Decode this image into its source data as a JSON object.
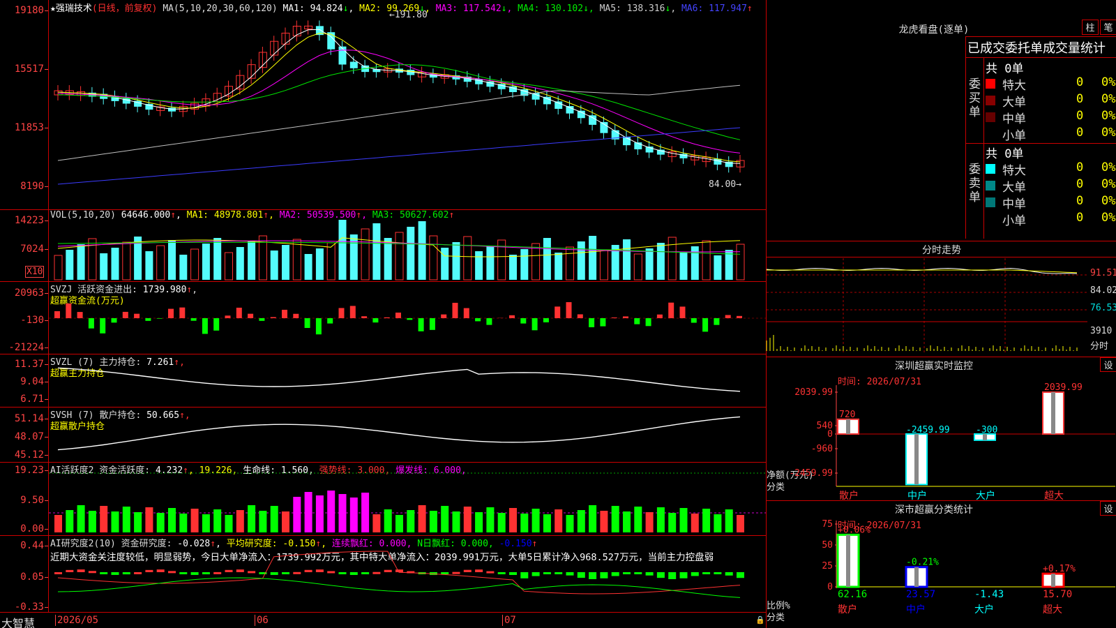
{
  "app": {
    "brand": "大智慧",
    "star": "★",
    "stock_name": "强瑞技术",
    "mode": "(日线，前复权)"
  },
  "colors": {
    "up": "#ff3232",
    "down": "#54fcfc",
    "ma1": "#ffffff",
    "ma2": "#ffff00",
    "ma3": "#ff00ff",
    "ma4": "#00e600",
    "ma5": "#c0c0c0",
    "ma6": "#3c3cff",
    "axis": "#ff4040",
    "grid": "#c00000",
    "green": "#00ff00",
    "magenta": "#ff00ff"
  },
  "kline": {
    "ma_prefix": "MA(5,10,20,30,60,120)",
    "ma": [
      {
        "label": "MA1:",
        "value": "94.824",
        "arrow": "↓"
      },
      {
        "label": "MA2:",
        "value": "99.269",
        "arrow": "↓"
      },
      {
        "label": "MA3:",
        "value": "117.542",
        "arrow": "↓"
      },
      {
        "label": "MA4:",
        "value": "130.102",
        "arrow": "↓"
      },
      {
        "label": "MA5:",
        "value": "138.316",
        "arrow": "↓"
      },
      {
        "label": "MA6:",
        "value": "117.947",
        "arrow": "↑"
      }
    ],
    "ticks": [
      "19180",
      "15517",
      "11853",
      "8190"
    ],
    "high_label": "191.80",
    "low_label": "84.00"
  },
  "vol": {
    "prefix": "VOL(5,10,20)",
    "value": "64646.000",
    "arrow": "↑",
    "ma": [
      {
        "label": "MA1:",
        "value": "48978.801",
        "arrow": "↑"
      },
      {
        "label": "MA2:",
        "value": "50539.500",
        "arrow": "↑"
      },
      {
        "label": "MA3:",
        "value": "50627.602",
        "arrow": "↑"
      }
    ],
    "ticks": [
      "14223",
      "7024"
    ],
    "unit": "X10"
  },
  "svzj": {
    "title": "SVZJ  活跃资金进出:",
    "value": "1739.980",
    "arrow": "↑",
    "subtitle": "超赢资金流(万元)",
    "ticks": [
      "20963",
      "-130",
      "-21224"
    ]
  },
  "svzl": {
    "title": "SVZL (7) 主力持仓:",
    "value": "7.261",
    "arrow": "↑,",
    "subtitle": "超赢主力持仓",
    "ticks": [
      "11.37",
      "9.04",
      "6.71"
    ]
  },
  "svsh": {
    "title": "SVSH (7) 散户持仓:",
    "value": "50.665",
    "arrow": "↑,",
    "subtitle": "超赢散户持仓",
    "ticks": [
      "51.14",
      "48.07",
      "45.12"
    ]
  },
  "ai1": {
    "title": "AI活跃度2 资金活跃度:",
    "value": "4.232",
    "v2": "19.226,",
    "v3": "生命线: 1.560,",
    "v4": "强势线: 3.000,",
    "v5": "爆发线: 6.000,",
    "ticks": [
      "19.23",
      "9.50",
      "0.00"
    ]
  },
  "ai2": {
    "title": "AI研究度2(10) 资金研究度:",
    "value": "-0.028",
    "v2": "平均研究度: -0.150",
    "v3": "连续飘红: 0.000,",
    "v4": "N日飘红: 0.000,",
    "v5": "-0.150",
    "ticks": [
      "0.44",
      "0.05",
      "-0.33"
    ],
    "comment": "近期大资金关注度较低，明显弱势，今日大单净流入：1739.992万元，其中特大单净流入：2039.991万元，大单5日累计净入968.527万元，当前主力控盘弱"
  },
  "dates": [
    "2026/05",
    "06",
    "07"
  ],
  "dragon": {
    "title": "龙虎看盘(逐单)",
    "tab1": "柱",
    "tab2": "笔",
    "header": "已成交委托单成交量统计",
    "buy": {
      "side": "委买单",
      "total": "共 0单",
      "rows": [
        {
          "name": "特大",
          "v": "0",
          "p": "0%"
        },
        {
          "name": "大单",
          "v": "0",
          "p": "0%"
        },
        {
          "name": "中单",
          "v": "0",
          "p": "0%"
        },
        {
          "name": "小单",
          "v": "0",
          "p": "0%"
        }
      ]
    },
    "sell": {
      "side": "委卖单",
      "total": "共 0单",
      "rows": [
        {
          "name": "特大",
          "v": "0",
          "p": "0%"
        },
        {
          "name": "大单",
          "v": "0",
          "p": "0%"
        },
        {
          "name": "中单",
          "v": "0",
          "p": "0%"
        },
        {
          "name": "小单",
          "v": "0",
          "p": "0%"
        }
      ]
    }
  },
  "intraday": {
    "title": "分时走势",
    "ticks": [
      "91.51",
      "84.02",
      "76.53"
    ],
    "vol_tick": "3910",
    "vol_label": "分时"
  },
  "monitor": {
    "title": "深圳超赢实时监控",
    "gear": "设",
    "time": "时间: 2026/07/31",
    "ticks": [
      "2039.99",
      "540",
      "0",
      "-960",
      "-2459.99"
    ],
    "ylabel": "净额(万元)",
    "xlabel": "分类",
    "chart_data": {
      "type": "bar",
      "categories": [
        "散户",
        "中户",
        "大户",
        "超大"
      ],
      "values": [
        720,
        -2459.99,
        -300,
        2039.99
      ],
      "labels": [
        "720",
        "-2459.99",
        "-300",
        "2039.99"
      ],
      "ylim": [
        -2459.99,
        2039.99
      ]
    }
  },
  "classify": {
    "title": "深市超赢分类统计",
    "gear": "设",
    "time": "时间: 2026/07/31",
    "ticks": [
      "75",
      "50",
      "25",
      "0"
    ],
    "ylabel": "比例%",
    "xlabel": "分类",
    "chart_data": {
      "type": "bar",
      "categories": [
        "散户",
        "中户",
        "大户",
        "超大"
      ],
      "values": [
        62.16,
        23.57,
        -1.43,
        15.7
      ],
      "pct_labels": [
        "+0.06%",
        "-0.21%",
        "",
        "+0.17%"
      ],
      "value_labels": [
        "62.16",
        "23.57",
        "-1.43",
        "15.70"
      ],
      "ylim": [
        0,
        75
      ]
    }
  }
}
